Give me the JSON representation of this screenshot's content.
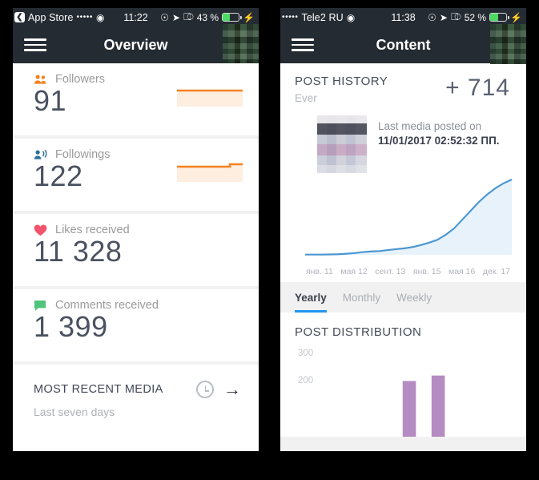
{
  "left": {
    "statusbar": {
      "back_label": "App Store",
      "back_icon": "chevron-left-icon",
      "signal_dots": "•••••",
      "wifi_icon": "wifi-icon",
      "time": "11:22",
      "rotation_icon": "rotation-lock-icon",
      "location_icon": "location-arrow-icon",
      "bluetooth_icon": "bluetooth-icon",
      "battery_percent": "43 %",
      "battery_fill": 43,
      "charging_icon": "lightning-bolt-icon"
    },
    "navbar": {
      "menu_icon": "hamburger-menu-icon",
      "title": "Overview",
      "avatar_icon": "user-avatar"
    },
    "cards": [
      {
        "icon": "people-icon",
        "icon_color": "#f58220",
        "label": "Followers",
        "value": "91",
        "spark_color": "#f58220",
        "spark_fill": "#fdeee0",
        "spark_step": false
      },
      {
        "icon": "person-broadcast-icon",
        "icon_color": "#2a6f97",
        "label": "Followings",
        "value": "122",
        "spark_color": "#f58220",
        "spark_fill": "#fdeee0",
        "spark_step": true
      },
      {
        "icon": "heart-icon",
        "icon_color": "#f2536d",
        "label": "Likes received",
        "value": "11 328",
        "spark_color": "",
        "spark_fill": "",
        "spark_step": false
      },
      {
        "icon": "comment-icon",
        "icon_color": "#4fc47a",
        "label": "Comments received",
        "value": "1 399",
        "spark_color": "",
        "spark_fill": "",
        "spark_step": false
      }
    ],
    "recent": {
      "title": "MOST RECENT MEDIA",
      "subtitle": "Last seven days",
      "clock_icon": "clock-icon",
      "arrow_icon": "arrow-right-icon"
    }
  },
  "right": {
    "statusbar": {
      "signal_dots": "•••••",
      "carrier": "Tele2 RU",
      "wifi_icon": "wifi-icon",
      "time": "11:38",
      "rotation_icon": "rotation-lock-icon",
      "location_icon": "location-arrow-icon",
      "bluetooth_icon": "bluetooth-icon",
      "battery_percent": "52 %",
      "battery_fill": 52,
      "charging_icon": "lightning-bolt-icon"
    },
    "navbar": {
      "menu_icon": "hamburger-menu-icon",
      "title": "Content",
      "avatar_icon": "user-avatar"
    },
    "post_history": {
      "title": "POST HISTORY",
      "subtitle": "Ever",
      "delta": "+ 714",
      "thumb_icon": "media-thumbnail",
      "media_line1": "Last media posted on",
      "media_line2": "11/01/2017 02:52:32 ПП."
    },
    "tabs": [
      {
        "label": "Yearly",
        "active": true
      },
      {
        "label": "Monthly",
        "active": false
      },
      {
        "label": "Weekly",
        "active": false
      }
    ],
    "post_distribution": {
      "title": "POST DISTRIBUTION"
    }
  },
  "chart_data": [
    {
      "type": "area",
      "title": "POST HISTORY",
      "subtitle": "Ever",
      "xlabel": "",
      "ylabel": "",
      "grid": false,
      "legend": "none",
      "line_color": "#4a97d2",
      "fill_color": "#e8f2fb",
      "tick_labels": [
        "янв. 11",
        "мая 12",
        "сент. 13",
        "янв. 15",
        "мая 16",
        "дек. 17"
      ],
      "x": [
        0,
        4,
        8,
        12,
        16,
        20,
        24,
        28,
        32,
        36,
        40,
        44,
        48,
        52,
        56,
        60,
        64,
        68,
        72,
        76,
        80,
        84,
        88,
        92,
        96,
        100
      ],
      "values": [
        2,
        2,
        2,
        3,
        5,
        9,
        14,
        22,
        27,
        30,
        38,
        45,
        52,
        62,
        78,
        97,
        120,
        160,
        210,
        280,
        350,
        420,
        480,
        530,
        570,
        600
      ],
      "ylim": [
        0,
        714
      ],
      "final_value": 714
    },
    {
      "type": "bar",
      "title": "POST DISTRIBUTION",
      "xlabel": "",
      "ylabel": "",
      "grid": false,
      "legend": "none",
      "bar_color": "#b58cc2",
      "categories": [
        "",
        "",
        "",
        "",
        "",
        "",
        ""
      ],
      "values": [
        0,
        0,
        0,
        205,
        225,
        0,
        0
      ],
      "ylim": [
        0,
        330
      ],
      "yticks": [
        200,
        300
      ],
      "ytick_labels": [
        "200",
        "300"
      ]
    }
  ]
}
